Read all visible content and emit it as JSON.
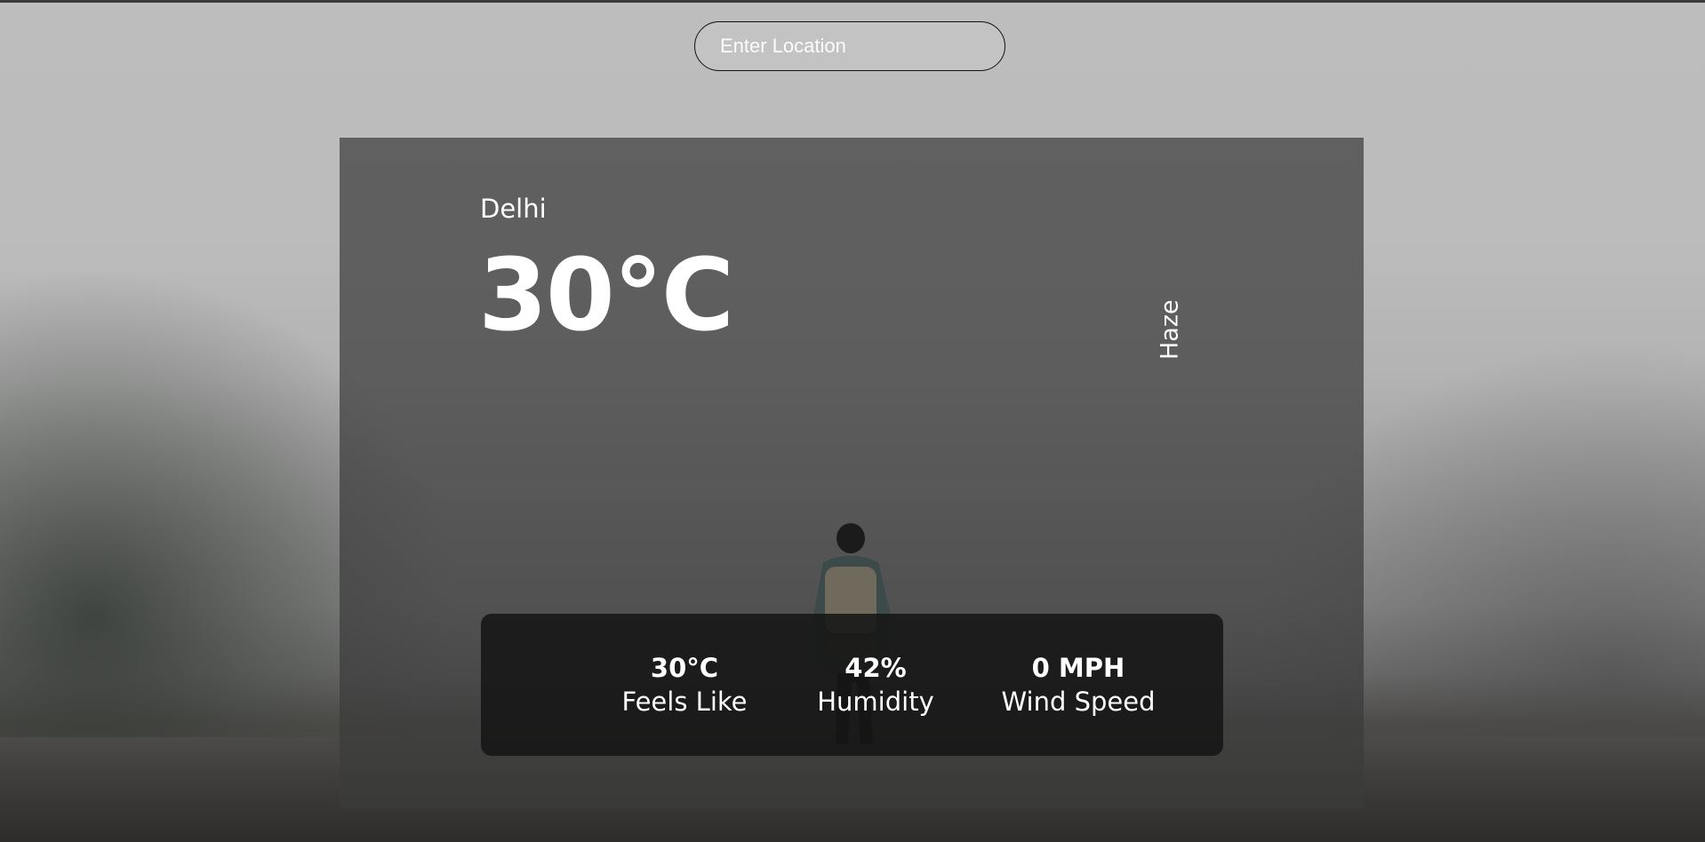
{
  "search": {
    "placeholder": "Enter Location",
    "value": ""
  },
  "weather": {
    "location": "Delhi",
    "temperature": "30°C",
    "condition": "Haze"
  },
  "stats": {
    "feels_like": {
      "value": "30°C",
      "label": "Feels Like"
    },
    "humidity": {
      "value": "42%",
      "label": "Humidity"
    },
    "wind_speed": {
      "value": "0 MPH",
      "label": "Wind Speed"
    }
  },
  "colors": {
    "text": "#ffffff",
    "card_bg": "#3c3c3c",
    "stats_bg": "#161616",
    "page_bg": "#bcbcbc"
  }
}
